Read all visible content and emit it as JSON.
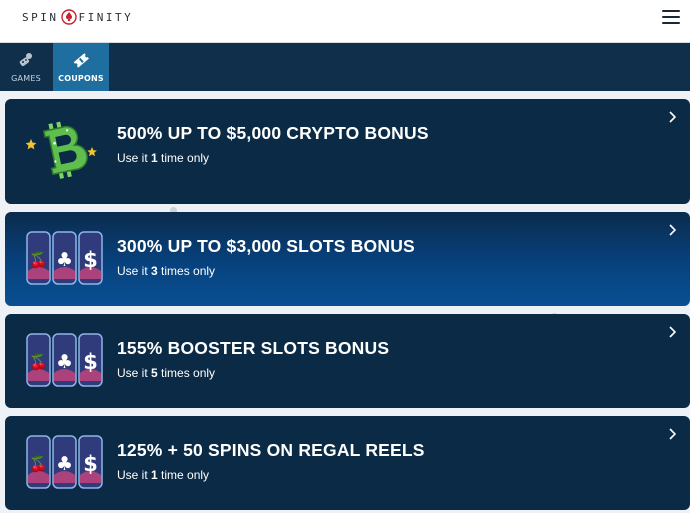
{
  "header": {
    "logo_left": "SPIN",
    "logo_right": "FINITY"
  },
  "nav": {
    "tabs": [
      {
        "label": "GAMES",
        "icon": "joystick-icon",
        "active": false
      },
      {
        "label": "COUPONS",
        "icon": "ticket-icon",
        "active": true
      }
    ]
  },
  "coupons": [
    {
      "title": "500% UP TO $5,000 CRYPTO BONUS",
      "prefix": "Use it ",
      "count": "1",
      "suffix": " time only",
      "image": "bitcoin-icon"
    },
    {
      "title": "300% UP TO $3,000 SLOTS BONUS",
      "prefix": "Use it ",
      "count": "3",
      "suffix": " times only",
      "image": "slot-reels-icon"
    },
    {
      "title": "155% BOOSTER SLOTS BONUS",
      "prefix": "Use it ",
      "count": "5",
      "suffix": " times only",
      "image": "slot-reels-icon"
    },
    {
      "title": "125% + 50 SPINS ON REGAL REELS",
      "prefix": "Use it ",
      "count": "1",
      "suffix": " time only",
      "image": "slot-reels-icon"
    }
  ],
  "colors": {
    "nav_bg": "#0f2f4a",
    "active_tab": "#1e6fa0",
    "card_bg": "#0b2a45",
    "highlight_card": "#07427e"
  }
}
